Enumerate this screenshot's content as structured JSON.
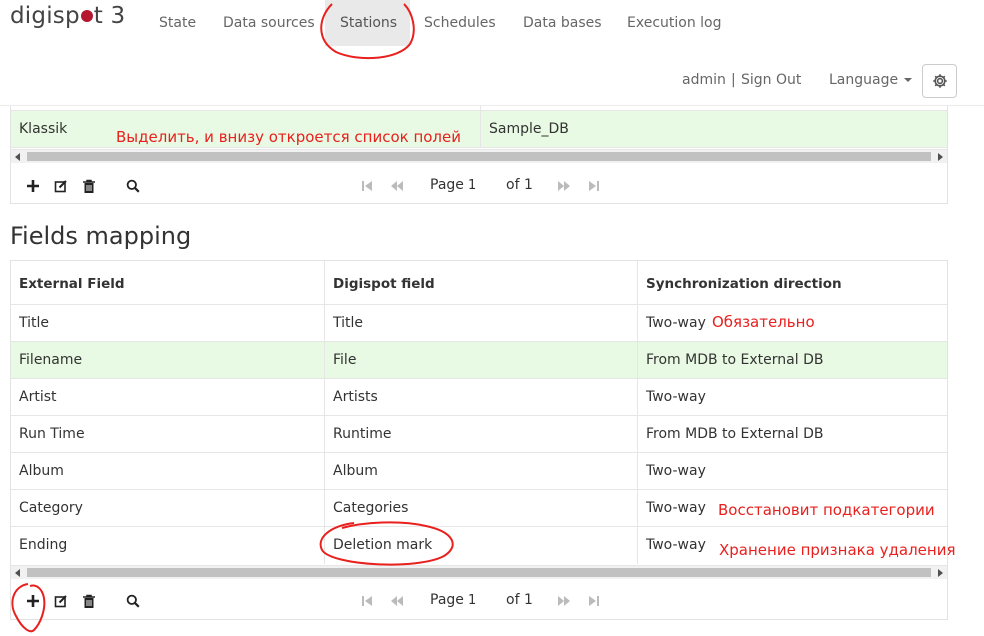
{
  "app": {
    "logo_text_pre": "digisp",
    "logo_text_post": "t 3"
  },
  "nav": {
    "items": [
      {
        "label": "State"
      },
      {
        "label": "Data sources"
      },
      {
        "label": "Stations",
        "active": true
      },
      {
        "label": "Schedules"
      },
      {
        "label": "Data bases"
      },
      {
        "label": "Execution log"
      }
    ],
    "user": "admin",
    "separator": "|",
    "sign_out": "Sign Out",
    "language": "Language",
    "settings_icon": "gear-icon"
  },
  "stations_table": {
    "selected_row": {
      "name": "Klassik",
      "database": "Sample_DB"
    },
    "pager": {
      "page_label": "Page",
      "page_value": "1",
      "of_label": "of 1"
    }
  },
  "fields_mapping": {
    "title": "Fields mapping",
    "columns": [
      "External Field",
      "Digispot field",
      "Synchronization direction"
    ],
    "rows": [
      [
        "Title",
        "Title",
        "Two-way"
      ],
      [
        "Filename",
        "File",
        "From MDB to External DB"
      ],
      [
        "Artist",
        "Artists",
        "Two-way"
      ],
      [
        "Run Time",
        "Runtime",
        "From MDB to External DB"
      ],
      [
        "Album",
        "Album",
        "Two-way"
      ],
      [
        "Category",
        "Categories",
        "Two-way"
      ],
      [
        "Ending",
        "Deletion mark",
        "Two-way"
      ]
    ],
    "selected_row_index": 1,
    "pager": {
      "page_label": "Page",
      "page_value": "1",
      "of_label": "of 1"
    }
  },
  "toolbar_icons": [
    "add-icon",
    "edit-icon",
    "delete-icon",
    "search-icon"
  ],
  "pager_icons": [
    "first-page-icon",
    "prev-page-icon",
    "next-page-icon",
    "last-page-icon"
  ],
  "annotations": {
    "select_note": "Выделить, и внизу откроется список полей",
    "required_note": "Обязательно",
    "restore_note": "Восстановит подкатегории",
    "storage_note": "Хранение признака удаления",
    "color": "#e8201e"
  },
  "colors": {
    "selected_row": "#e8fae3",
    "nav_active": "#e9e9e9",
    "logo_dot": "#b4172f"
  }
}
